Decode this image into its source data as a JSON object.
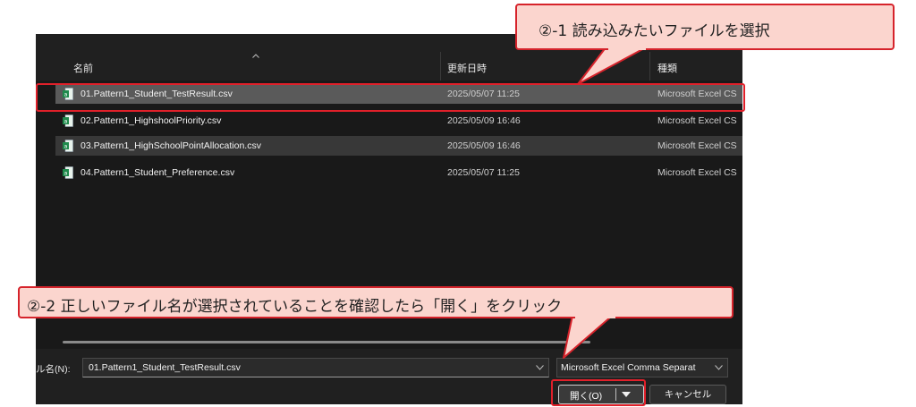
{
  "file_list": {
    "columns": {
      "name": "名前",
      "date": "更新日時",
      "type": "種類"
    },
    "rows": [
      {
        "name": "01.Pattern1_Student_TestResult.csv",
        "date": "2025/05/07 11:25",
        "type": "Microsoft Excel CS"
      },
      {
        "name": "02.Pattern1_HighshoolPriority.csv",
        "date": "2025/05/09 16:46",
        "type": "Microsoft Excel CS"
      },
      {
        "name": "03.Pattern1_HighSchoolPointAllocation.csv",
        "date": "2025/05/09 16:46",
        "type": "Microsoft Excel CS"
      },
      {
        "name": "04.Pattern1_Student_Preference.csv",
        "date": "2025/05/07 11:25",
        "type": "Microsoft Excel CS"
      }
    ]
  },
  "bottom_bar": {
    "filename_label": "ル名(N):",
    "filename_value": "01.Pattern1_Student_TestResult.csv",
    "filetype_value": "Microsoft Excel Comma Separat",
    "open_label": "開く(O)",
    "cancel_label": "キャンセル"
  },
  "annotations": {
    "callout1": "②-1 読み込みたいファイルを選択",
    "callout2": "②-2 正しいファイル名が選択されていることを確認したら「開く」をクリック"
  },
  "colors": {
    "dialog_bg": "#191919",
    "selected_row": "#5a5a5a",
    "callout_fill": "#fbd5ce",
    "annotation_red": "#e0202a",
    "excel_green": "#1f8a4c"
  },
  "icons": [
    "sort-caret-icon",
    "excel-csv-file-icon",
    "chevron-down-icon"
  ]
}
